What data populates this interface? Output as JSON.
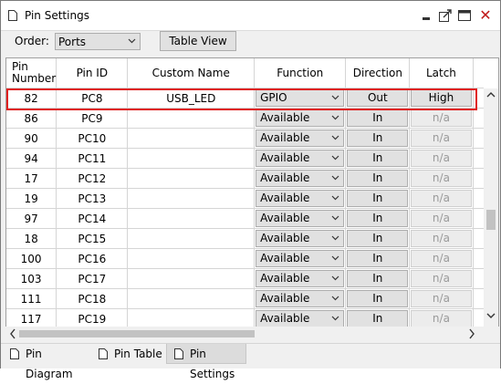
{
  "window": {
    "title": "Pin Settings"
  },
  "toolbar": {
    "order_label": "Order:",
    "order_value": "Ports",
    "table_view_label": "Table View"
  },
  "columns": {
    "pin_number_1": "Pin",
    "pin_number_2": "Number",
    "pin_id": "Pin ID",
    "custom_name": "Custom Name",
    "function": "Function",
    "direction": "Direction",
    "latch": "Latch"
  },
  "rows": [
    {
      "pin": "82",
      "id": "PC8",
      "name": "USB_LED",
      "function": "GPIO",
      "direction": "Out",
      "latch": "High",
      "latch_enabled": true
    },
    {
      "pin": "86",
      "id": "PC9",
      "name": "",
      "function": "Available",
      "direction": "In",
      "latch": "n/a",
      "latch_enabled": false
    },
    {
      "pin": "90",
      "id": "PC10",
      "name": "",
      "function": "Available",
      "direction": "In",
      "latch": "n/a",
      "latch_enabled": false
    },
    {
      "pin": "94",
      "id": "PC11",
      "name": "",
      "function": "Available",
      "direction": "In",
      "latch": "n/a",
      "latch_enabled": false
    },
    {
      "pin": "17",
      "id": "PC12",
      "name": "",
      "function": "Available",
      "direction": "In",
      "latch": "n/a",
      "latch_enabled": false
    },
    {
      "pin": "19",
      "id": "PC13",
      "name": "",
      "function": "Available",
      "direction": "In",
      "latch": "n/a",
      "latch_enabled": false
    },
    {
      "pin": "97",
      "id": "PC14",
      "name": "",
      "function": "Available",
      "direction": "In",
      "latch": "n/a",
      "latch_enabled": false
    },
    {
      "pin": "18",
      "id": "PC15",
      "name": "",
      "function": "Available",
      "direction": "In",
      "latch": "n/a",
      "latch_enabled": false
    },
    {
      "pin": "100",
      "id": "PC16",
      "name": "",
      "function": "Available",
      "direction": "In",
      "latch": "n/a",
      "latch_enabled": false
    },
    {
      "pin": "103",
      "id": "PC17",
      "name": "",
      "function": "Available",
      "direction": "In",
      "latch": "n/a",
      "latch_enabled": false
    },
    {
      "pin": "111",
      "id": "PC18",
      "name": "",
      "function": "Available",
      "direction": "In",
      "latch": "n/a",
      "latch_enabled": false
    },
    {
      "pin": "117",
      "id": "PC19",
      "name": "",
      "function": "Available",
      "direction": "In",
      "latch": "n/a",
      "latch_enabled": false
    }
  ],
  "tabs": [
    {
      "label": "Pin Diagram",
      "active": false
    },
    {
      "label": "Pin Table",
      "active": false
    },
    {
      "label": "Pin Settings",
      "active": true
    }
  ],
  "colors": {
    "selection_outline": "#e02020",
    "close_icon": "#c01818"
  },
  "icons": {
    "title": "document-icon",
    "minimize": "minimize-icon",
    "float": "float-window-icon",
    "maximize": "maximize-icon",
    "close": "close-icon"
  }
}
